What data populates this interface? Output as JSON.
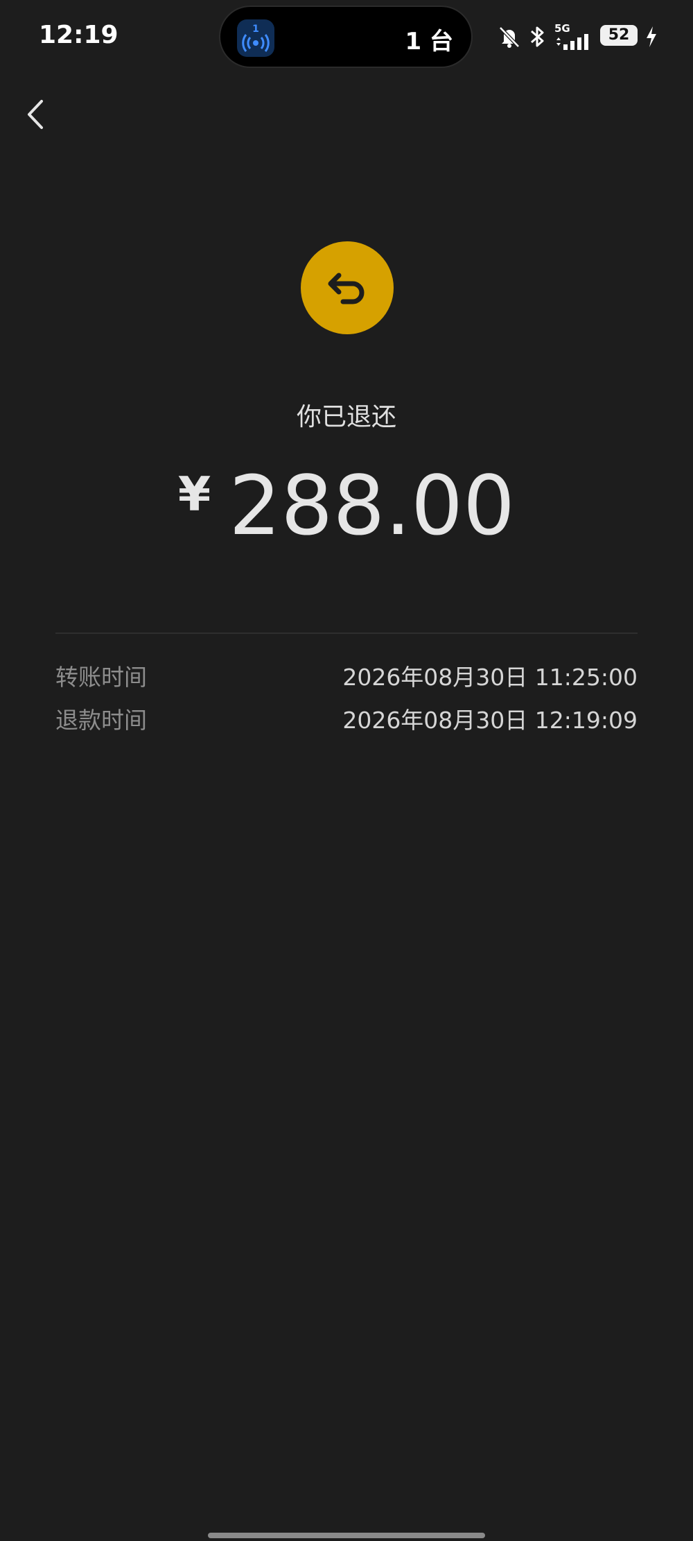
{
  "status_bar": {
    "time": "12:19",
    "island_app_badge": "1",
    "island_count": "1 台",
    "network": "5G",
    "battery": "52",
    "icons": [
      "app-radio-icon",
      "bell-muted-icon",
      "bluetooth-icon",
      "signal-icon",
      "battery-icon",
      "charging-icon"
    ]
  },
  "nav": {
    "back_icon": "chevron-left-icon"
  },
  "refund": {
    "badge_icon": "return-arrow-icon",
    "title": "你已退还",
    "currency": "¥",
    "amount": "288.00"
  },
  "details": [
    {
      "label": "转账时间",
      "value": "2026年08月30日 11:25:00"
    },
    {
      "label": "退款时间",
      "value": "2026年08月30日 12:19:09"
    }
  ],
  "colors": {
    "background": "#1d1d1d",
    "accent": "#d6a100",
    "primary_text": "#e6e6e6",
    "secondary_text": "#8d8d8d"
  }
}
